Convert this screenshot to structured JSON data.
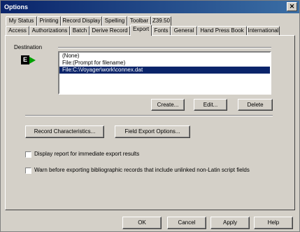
{
  "window": {
    "title": "Options",
    "close_glyph": "✕"
  },
  "tabs_row1": [
    {
      "label": "My Status"
    },
    {
      "label": "Printing"
    },
    {
      "label": "Record Display"
    },
    {
      "label": "Spelling"
    },
    {
      "label": "Toolbar"
    },
    {
      "label": "Z39.50"
    }
  ],
  "tabs_row2": [
    {
      "label": "Access"
    },
    {
      "label": "Authorizations"
    },
    {
      "label": "Batch"
    },
    {
      "label": "Derive Record"
    },
    {
      "label": "Export"
    },
    {
      "label": "Fonts"
    },
    {
      "label": "General"
    },
    {
      "label": "Hand Press Book"
    },
    {
      "label": "International"
    }
  ],
  "active_tab": "Export",
  "destination": {
    "label": "Destination",
    "icon_letter": "E",
    "items": [
      {
        "label": "(None)"
      },
      {
        "label": "File:(Prompt for filename)"
      },
      {
        "label": "File:C:\\Voyager\\work\\connex.dat"
      }
    ],
    "selected_index": 2,
    "create_label": "Create...",
    "edit_label": "Edit...",
    "delete_label": "Delete"
  },
  "options": {
    "record_characteristics_label": "Record Characteristics...",
    "field_export_options_label": "Field Export Options...",
    "display_report_label": "Display report for immediate export results",
    "display_report_checked": false,
    "warn_label": "Warn before exporting bibliographic records that include unlinked non-Latin script fields",
    "warn_checked": false
  },
  "footer": {
    "ok_label": "OK",
    "cancel_label": "Cancel",
    "apply_label": "Apply",
    "help_label": "Help"
  }
}
